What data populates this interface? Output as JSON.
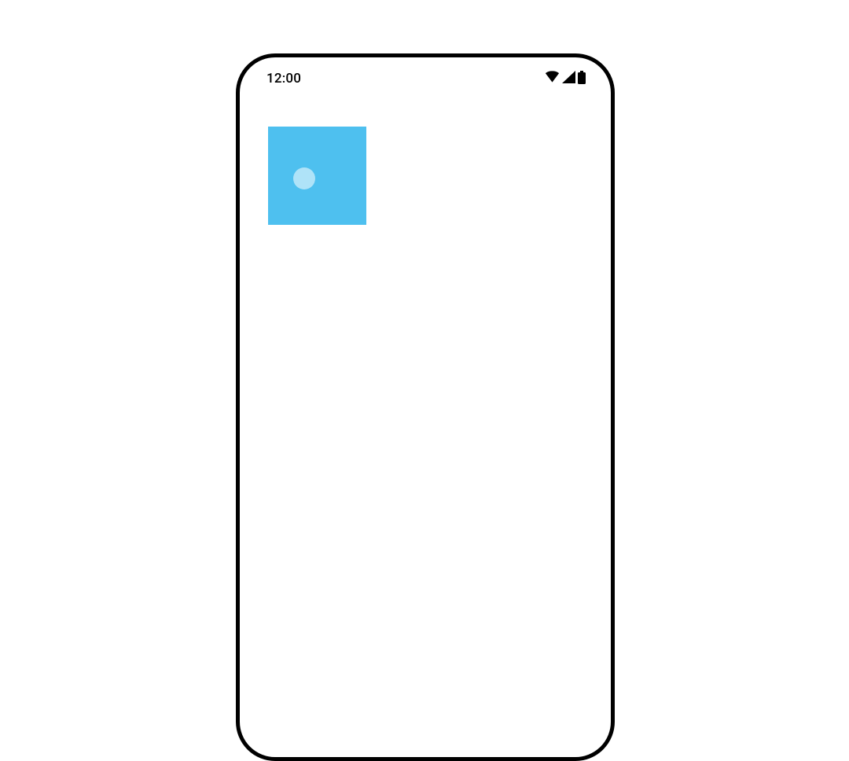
{
  "statusBar": {
    "time": "12:00"
  },
  "colors": {
    "box": "#4ec0ef",
    "touchDot": "rgba(255,255,255,0.55)",
    "frame": "#000000"
  }
}
